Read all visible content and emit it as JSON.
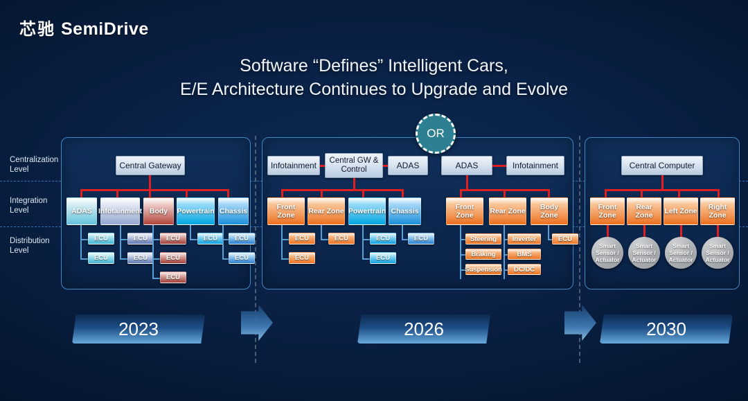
{
  "brand": {
    "cn": "芯驰",
    "en": "SemiDrive"
  },
  "title": {
    "line1": "Software “Defines” Intelligent Cars,",
    "line2": "E/E Architecture Continues to Upgrade and Evolve"
  },
  "levels": [
    {
      "line1": "Centralization",
      "line2": "Level"
    },
    {
      "line1": "Integration",
      "line2": "Level"
    },
    {
      "line1": "Distribution",
      "line2": "Level"
    }
  ],
  "or_badge": "OR",
  "years": [
    "2023",
    "2026",
    "2030"
  ],
  "panels": {
    "y2023": {
      "central": "Central Gateway",
      "domains": [
        {
          "label": "ADAS",
          "ecus": [
            "ECU",
            "ECU"
          ]
        },
        {
          "label": "Infotainment",
          "ecus": [
            "ECU",
            "ECU"
          ]
        },
        {
          "label": "Body",
          "ecus": [
            "ECU",
            "ECU",
            "ECU"
          ]
        },
        {
          "label": "Powertrain",
          "ecus": [
            "ECU"
          ]
        },
        {
          "label": "Chassis",
          "ecus": [
            "ECU",
            "ECU"
          ]
        }
      ]
    },
    "y2026a": {
      "top": [
        "Infotainment",
        "Central GW & Control",
        "ADAS"
      ],
      "domains": [
        {
          "label": "Front Zone",
          "ecus": [
            "ECU",
            "ECU"
          ]
        },
        {
          "label": "Rear Zone",
          "ecus": [
            "ECU"
          ]
        },
        {
          "label": "Powertrain",
          "ecus": [
            "ECU",
            "ECU"
          ]
        },
        {
          "label": "Chassis",
          "ecus": [
            "ECU"
          ]
        }
      ]
    },
    "y2026b": {
      "top": [
        "ADAS",
        "Infotainment"
      ],
      "domains": [
        {
          "label": "Front Zone",
          "ecus": [
            "Steering",
            "Braking",
            "Suspension"
          ]
        },
        {
          "label": "Rear Zone",
          "ecus": [
            "Inverter",
            "BMS",
            "DC/DC"
          ]
        },
        {
          "label": "Body Zone",
          "ecus": [
            "ECU"
          ]
        }
      ]
    },
    "y2030": {
      "central": "Central Computer",
      "domains": [
        {
          "label": "Front Zone",
          "node": "Smart Sensor / Actuator"
        },
        {
          "label": "Rear Zone",
          "node": "Smart Sensor / Actuator"
        },
        {
          "label": "Left  Zone",
          "node": "Smart Sensor / Actuator"
        },
        {
          "label": "Right Zone",
          "node": "Smart Sensor / Actuator"
        }
      ]
    }
  },
  "colors": {
    "red_link": "#e02020",
    "blue_link": "#5c9fd4",
    "orange": "#ed7020",
    "teal": "#2d7f92",
    "panel_border": "#3f88c8",
    "background": "#061a38"
  }
}
